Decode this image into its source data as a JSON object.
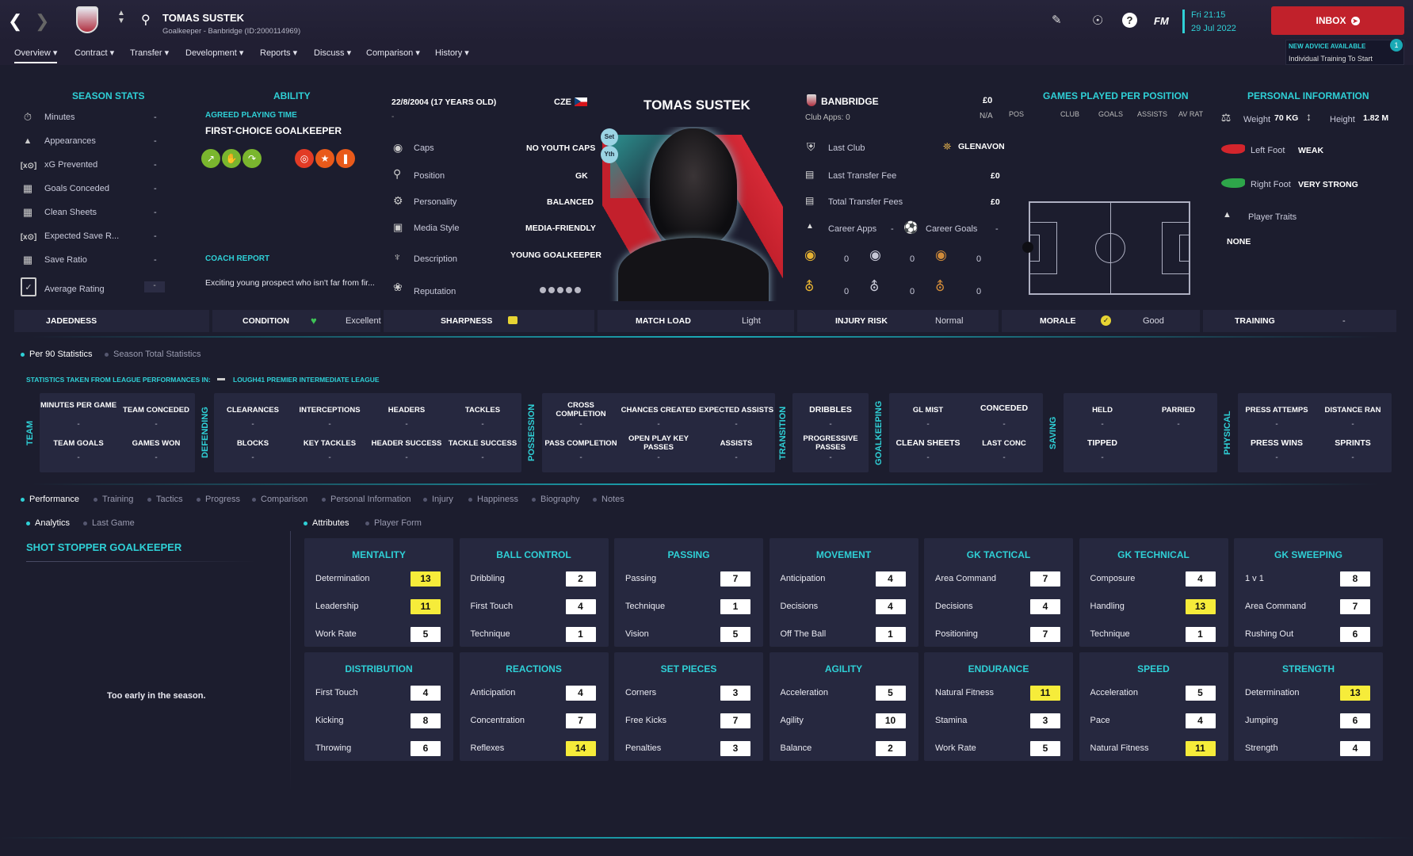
{
  "header": {
    "player_name": "TOMAS SUSTEK",
    "subtitle": "Goalkeeper - Banbridge (ID:2000114969)",
    "fm_label": "FM",
    "date_line1": "Fri 21:15",
    "date_line2": "29 Jul 2022",
    "inbox_label": "INBOX",
    "advice_title": "NEW ADVICE AVAILABLE",
    "advice_text": "Individual Training To Start",
    "advice_count": "1"
  },
  "menu": [
    {
      "label": "Overview"
    },
    {
      "label": "Contract"
    },
    {
      "label": "Transfer"
    },
    {
      "label": "Development"
    },
    {
      "label": "Reports"
    },
    {
      "label": "Discuss"
    },
    {
      "label": "Comparison"
    },
    {
      "label": "History"
    }
  ],
  "season_stats": {
    "title": "SEASON STATS",
    "rows": [
      {
        "label": "Minutes",
        "value": "-"
      },
      {
        "label": "Appearances",
        "value": "-"
      },
      {
        "label": "xG Prevented",
        "value": "-"
      },
      {
        "label": "Goals Conceded",
        "value": "-"
      },
      {
        "label": "Clean Sheets",
        "value": "-"
      },
      {
        "label": "Expected Save R...",
        "value": "-"
      },
      {
        "label": "Save Ratio",
        "value": "-"
      },
      {
        "label": "Average Rating",
        "value": "-"
      }
    ]
  },
  "ability": {
    "title": "ABILITY",
    "playing_time_label": "AGREED PLAYING TIME",
    "playing_time": "FIRST-CHOICE GOALKEEPER",
    "coach_report_label": "COACH REPORT",
    "coach_report": "Exciting young prospect who isn't far from fir..."
  },
  "bio": {
    "dob": "22/8/2004 (17 YEARS OLD)",
    "nation": "CZE",
    "dash": "-",
    "rows": [
      {
        "label": "Caps",
        "value": "NO YOUTH CAPS"
      },
      {
        "label": "Position",
        "value": "GK"
      },
      {
        "label": "Personality",
        "value": "BALANCED"
      },
      {
        "label": "Media Style",
        "value": "MEDIA-FRIENDLY"
      },
      {
        "label": "Description",
        "value": "YOUNG GOALKEEPER"
      },
      {
        "label": "Reputation",
        "value": ""
      }
    ]
  },
  "portrait": {
    "name": "TOMAS SUSTEK",
    "badge_set": "Set",
    "badge_yth": "Yth"
  },
  "club": {
    "name": "BANBRIDGE",
    "club_apps": "Club Apps:  0",
    "value": "£0",
    "na": "N/A",
    "last_club_label": "Last Club",
    "last_club": "GLENAVON",
    "last_fee_label": "Last Transfer Fee",
    "last_fee": "£0",
    "total_fee_label": "Total Transfer Fees",
    "total_fee": "£0",
    "career_apps_label": "Career Apps",
    "career_apps": "-",
    "career_goals_label": "Career Goals",
    "career_goals": "-",
    "medals_row1": [
      "0",
      "0",
      "0"
    ],
    "medals_row2": [
      "0",
      "0",
      "0"
    ]
  },
  "games_per_position": {
    "title": "GAMES PLAYED PER POSITION",
    "cols": [
      "POS",
      "CLUB",
      "GOALS",
      "ASSISTS",
      "AV RAT"
    ]
  },
  "personal": {
    "title": "PERSONAL INFORMATION",
    "weight_label": "Weight",
    "weight": "70 KG",
    "height_label": "Height",
    "height": "1.82 M",
    "left_foot_label": "Left Foot",
    "left_foot": "WEAK",
    "right_foot_label": "Right Foot",
    "right_foot": "VERY STRONG",
    "traits_label": "Player Traits",
    "traits": "NONE"
  },
  "status_strip": [
    {
      "title": "JADEDNESS",
      "value": ""
    },
    {
      "title": "CONDITION",
      "value": "Excellent"
    },
    {
      "title": "SHARPNESS",
      "value": ""
    },
    {
      "title": "MATCH LOAD",
      "value": "Light"
    },
    {
      "title": "INJURY RISK",
      "value": "Normal"
    },
    {
      "title": "MORALE",
      "value": "Good"
    },
    {
      "title": "TRAINING",
      "value": "-"
    }
  ],
  "stats_tabs": {
    "per90": "Per 90 Statistics",
    "season_total": "Season Total Statistics",
    "source_label": "STATISTICS TAKEN FROM LEAGUE PERFORMANCES IN:",
    "league": "LOUGH41 PREMIER INTERMEDIATE LEAGUE"
  },
  "stat_groups": [
    {
      "name": "TEAM",
      "cells": [
        [
          "MINUTES PER GAME",
          "TEAM CONCEDED"
        ],
        [
          "TEAM GOALS",
          "GAMES WON"
        ]
      ]
    },
    {
      "name": "DEFENDING",
      "cells": [
        [
          "CLEARANCES",
          "INTERCEPTIONS",
          "HEADERS",
          "TACKLES"
        ],
        [
          "BLOCKS",
          "KEY TACKLES",
          "HEADER SUCCESS",
          "TACKLE SUCCESS"
        ]
      ]
    },
    {
      "name": "POSSESSION",
      "cells": [
        [
          "CROSS COMPLETION",
          "CHANCES CREATED",
          "EXPECTED ASSISTS"
        ],
        [
          "PASS COMPLETION",
          "OPEN PLAY KEY PASSES",
          "ASSISTS"
        ]
      ]
    },
    {
      "name": "TRANSITION",
      "cells": [
        [
          "DRIBBLES"
        ],
        [
          "PROGRESSIVE PASSES"
        ]
      ]
    },
    {
      "name": "GOALKEEPING",
      "cells": [
        [
          "GL MIST",
          "CONCEDED"
        ],
        [
          "CLEAN SHEETS",
          "LAST CONC"
        ]
      ]
    },
    {
      "name": "SAVING",
      "cells": [
        [
          "HELD",
          "PARRIED"
        ],
        [
          "TIPPED",
          ""
        ]
      ]
    },
    {
      "name": "PHYSICAL",
      "cells": [
        [
          "PRESS ATTEMPS",
          "DISTANCE RAN"
        ],
        [
          "PRESS WINS",
          "SPRINTS"
        ]
      ]
    }
  ],
  "lower_tabs": [
    "Performance",
    "Training",
    "Tactics",
    "Progress",
    "Comparison",
    "Personal Information",
    "Injury",
    "Happiness",
    "Biography",
    "Notes"
  ],
  "analytics_tabs": [
    "Analytics",
    "Last Game"
  ],
  "attr_tabs": [
    "Attributes",
    "Player Form"
  ],
  "analytics": {
    "role": "SHOT STOPPER GOALKEEPER",
    "message": "Too early in the season."
  },
  "attributes": [
    {
      "title": "MENTALITY",
      "rows": [
        [
          "Determination",
          "13"
        ],
        [
          "Leadership",
          "11"
        ],
        [
          "Work Rate",
          "5"
        ]
      ]
    },
    {
      "title": "BALL CONTROL",
      "rows": [
        [
          "Dribbling",
          "2"
        ],
        [
          "First Touch",
          "4"
        ],
        [
          "Technique",
          "1"
        ]
      ]
    },
    {
      "title": "PASSING",
      "rows": [
        [
          "Passing",
          "7"
        ],
        [
          "Technique",
          "1"
        ],
        [
          "Vision",
          "5"
        ]
      ]
    },
    {
      "title": "MOVEMENT",
      "rows": [
        [
          "Anticipation",
          "4"
        ],
        [
          "Decisions",
          "4"
        ],
        [
          "Off The Ball",
          "1"
        ]
      ]
    },
    {
      "title": "GK TACTICAL",
      "rows": [
        [
          "Area Command",
          "7"
        ],
        [
          "Decisions",
          "4"
        ],
        [
          "Positioning",
          "7"
        ]
      ]
    },
    {
      "title": "GK TECHNICAL",
      "rows": [
        [
          "Composure",
          "4"
        ],
        [
          "Handling",
          "13"
        ],
        [
          "Technique",
          "1"
        ]
      ]
    },
    {
      "title": "GK SWEEPING",
      "rows": [
        [
          "1 v 1",
          "8"
        ],
        [
          "Area Command",
          "7"
        ],
        [
          "Rushing Out",
          "6"
        ]
      ]
    },
    {
      "title": "DISTRIBUTION",
      "rows": [
        [
          "First Touch",
          "4"
        ],
        [
          "Kicking",
          "8"
        ],
        [
          "Throwing",
          "6"
        ]
      ]
    },
    {
      "title": "REACTIONS",
      "rows": [
        [
          "Anticipation",
          "4"
        ],
        [
          "Concentration",
          "7"
        ],
        [
          "Reflexes",
          "14"
        ]
      ]
    },
    {
      "title": "SET PIECES",
      "rows": [
        [
          "Corners",
          "3"
        ],
        [
          "Free Kicks",
          "7"
        ],
        [
          "Penalties",
          "3"
        ]
      ]
    },
    {
      "title": "AGILITY",
      "rows": [
        [
          "Acceleration",
          "5"
        ],
        [
          "Agility",
          "10"
        ],
        [
          "Balance",
          "2"
        ]
      ]
    },
    {
      "title": "ENDURANCE",
      "rows": [
        [
          "Natural Fitness",
          "11"
        ],
        [
          "Stamina",
          "3"
        ],
        [
          "Work Rate",
          "5"
        ]
      ]
    },
    {
      "title": "SPEED",
      "rows": [
        [
          "Acceleration",
          "5"
        ],
        [
          "Pace",
          "4"
        ],
        [
          "Natural Fitness",
          "11"
        ]
      ]
    },
    {
      "title": "STRENGTH",
      "rows": [
        [
          "Determination",
          "13"
        ],
        [
          "Jumping",
          "6"
        ],
        [
          "Strength",
          "4"
        ]
      ]
    }
  ],
  "colors": {
    "accent": "#2fd0d6",
    "highlight": "#f6ec3a",
    "inbox": "#c1212b",
    "background": "#1c1d2e"
  }
}
